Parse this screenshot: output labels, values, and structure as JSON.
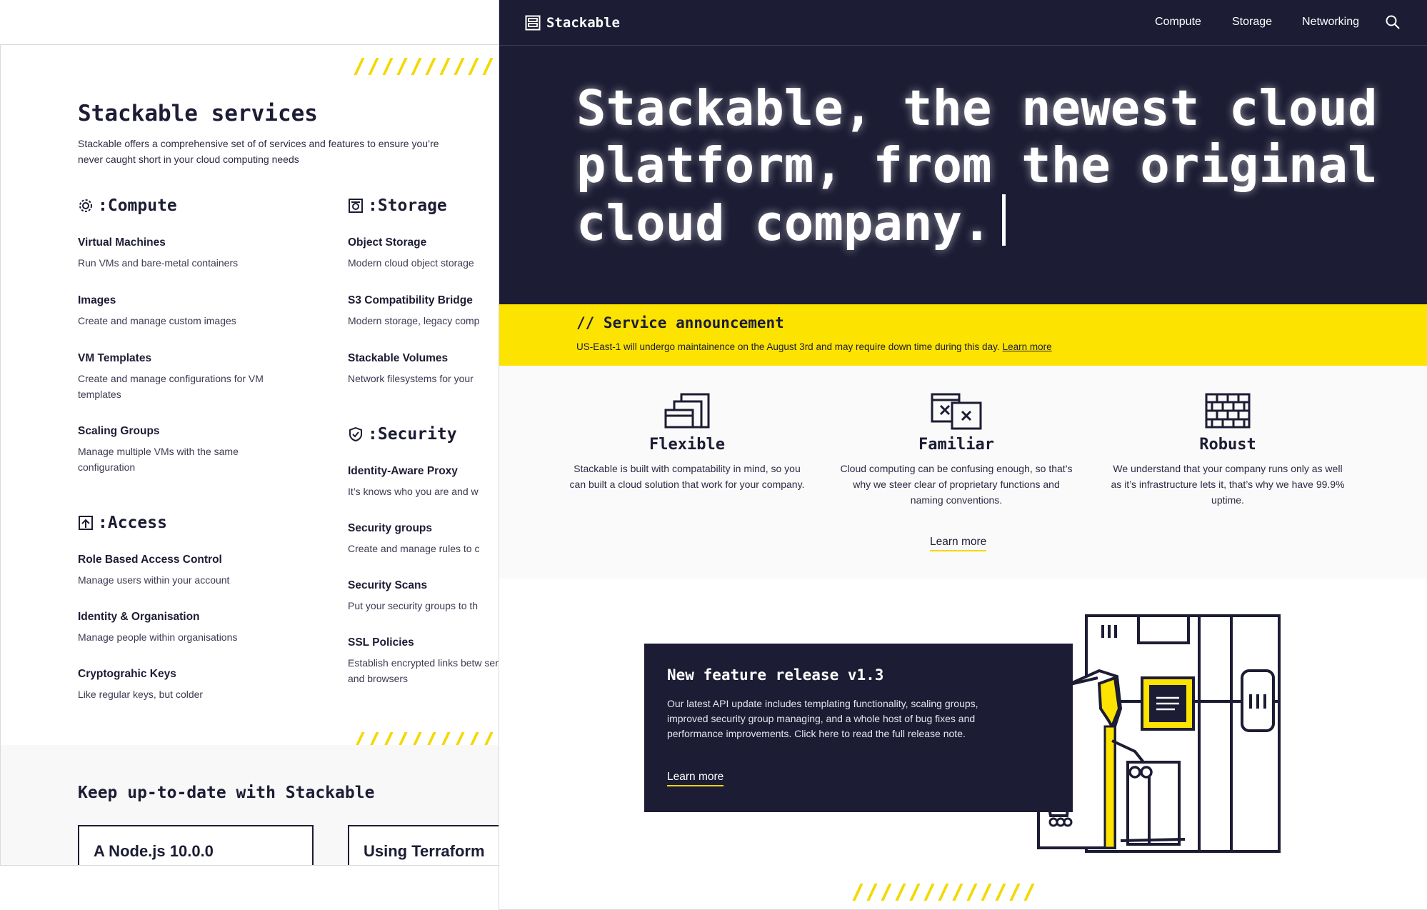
{
  "colors": {
    "navy": "#1c1c34",
    "yellow": "#fce300",
    "stripe_yellow": "#f4d800",
    "light_bg": "#fafafa"
  },
  "services_page": {
    "title": "Stackable services",
    "intro": "Stackable offers a comprehensive set of of services and features to ensure you’re never caught short in your cloud computing needs",
    "compute": {
      "heading": ":Compute",
      "icon": "gear-icon",
      "items": [
        {
          "name": "Virtual Machines",
          "desc": "Run VMs and bare-metal containers"
        },
        {
          "name": "Images",
          "desc": "Create and manage custom images"
        },
        {
          "name": "VM Templates",
          "desc": "Create and manage configurations for VM templates"
        },
        {
          "name": "Scaling Groups",
          "desc": "Manage multiple VMs with the same configuration"
        }
      ]
    },
    "storage": {
      "heading": ":Storage",
      "icon": "storage-icon",
      "items": [
        {
          "name": "Object Storage",
          "desc": "Modern cloud object storage"
        },
        {
          "name": "S3 Compatibility Bridge",
          "desc": "Modern storage, legacy comp"
        },
        {
          "name": "Stackable Volumes",
          "desc": "Network filesystems for your"
        }
      ]
    },
    "access": {
      "heading": ":Access",
      "icon": "access-icon",
      "items": [
        {
          "name": "Role Based Access Control",
          "desc": "Manage users within your account"
        },
        {
          "name": "Identity & Organisation",
          "desc": "Manage people within organisations"
        },
        {
          "name": "Cryptograhic Keys",
          "desc": "Like regular keys, but colder"
        }
      ]
    },
    "security": {
      "heading": ":Security",
      "icon": "shield-icon",
      "items": [
        {
          "name": "Identity-Aware Proxy",
          "desc": "It’s knows who you are and w"
        },
        {
          "name": "Security groups",
          "desc": "Create and manage rules to c"
        },
        {
          "name": "Security Scans",
          "desc": "Put your security groups to th"
        },
        {
          "name": "SSL Policies",
          "desc": "Establish encrypted links betw servers and browsers"
        }
      ]
    },
    "keep_up": {
      "title": "Keep up-to-date with Stackable",
      "cards": [
        "A Node.js 10.0.0",
        "Using Terraform"
      ]
    }
  },
  "home_page": {
    "nav": {
      "logo": "Stackable",
      "links": [
        "Compute",
        "Storage",
        "Networking"
      ],
      "search_icon": "search-icon"
    },
    "hero": {
      "title": "Stackable, the newest cloud platform, from the original cloud company."
    },
    "announcement": {
      "title": "// Service announcement",
      "text": "US-East-1 will undergo maintainence on the August 3rd and may require down time during this day.",
      "link": "Learn more"
    },
    "features": [
      {
        "title": "Flexible",
        "desc": "Stackable is built with compatability in mind, so you can built a cloud solution that work for your company.",
        "icon": "stacked-windows-icon"
      },
      {
        "title": "Familiar",
        "desc": "Cloud computing can be confusing enough, so that’s why we steer clear of proprietary functions and naming conventions.",
        "icon": "windows-x-icon"
      },
      {
        "title": "Robust",
        "desc": "We understand that your company runs only as well as it’s infrastructure lets it, that’s why we have 99.9% uptime.",
        "icon": "brick-wall-icon"
      }
    ],
    "features_link": "Learn more",
    "release": {
      "title": "New feature release v1.3",
      "text": "Our latest API update includes templating functionality, scaling groups, improved security group managing, and a whole host of bug fixes and performance improvements. Click here to read the full release note.",
      "link": "Learn more"
    }
  }
}
